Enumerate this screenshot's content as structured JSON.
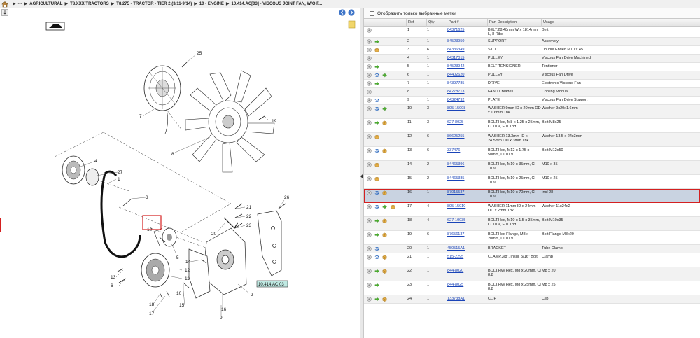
{
  "breadcrumb": {
    "items": [
      "---",
      "AGRICULTURAL",
      "T8.XXX TRACTORS",
      "T8.275 - TRACTOR - TIER 2 (3/11-9/14)",
      "10 - ENGINE",
      "10.414.AC[03] - VISCOUS JOINT FAN, W/O F..."
    ]
  },
  "filter": {
    "label": "Отобразить только выбранные метки"
  },
  "table": {
    "headers": [
      "Ref",
      "Qty",
      "Part #",
      "Part Description",
      "Usage"
    ],
    "rows": [
      {
        "ref": "1",
        "qty": "1",
        "part": "84371625",
        "desc": "BELT,28.48mm W x 1814mm L, 8 Ribs",
        "usage": "Belt",
        "icons": [
          "info"
        ]
      },
      {
        "ref": "2",
        "qty": "1",
        "part": "84523950",
        "desc": "SUPPORT",
        "usage": "Assembly",
        "icons": [
          "info",
          "arrow"
        ]
      },
      {
        "ref": "3",
        "qty": "6",
        "part": "84336349",
        "desc": "STUD",
        "usage": "Double Ended M10 x 45",
        "icons": [
          "info",
          "box"
        ]
      },
      {
        "ref": "4",
        "qty": "1",
        "part": "84317015",
        "desc": "PULLEY",
        "usage": "Viscous Fan Drive Machined",
        "icons": [
          "info"
        ]
      },
      {
        "ref": "5",
        "qty": "1",
        "part": "84523942",
        "desc": "BELT TENSIONER",
        "usage": "Tentioner",
        "icons": [
          "info",
          "arrow"
        ]
      },
      {
        "ref": "6",
        "qty": "1",
        "part": "84402620",
        "desc": "PULLEY",
        "usage": "Viscous Fan Drive",
        "icons": [
          "info",
          "swap",
          "arrow"
        ]
      },
      {
        "ref": "7",
        "qty": "1",
        "part": "84397785",
        "desc": "DRIVE",
        "usage": "Electronic Viscous Fan",
        "icons": [
          "info",
          "arrow"
        ]
      },
      {
        "ref": "8",
        "qty": "1",
        "part": "84278713",
        "desc": "FAN,11 Blades",
        "usage": "Cooling Modual",
        "icons": [
          "info"
        ]
      },
      {
        "ref": "9",
        "qty": "1",
        "part": "84324792",
        "desc": "PLATE",
        "usage": "Viscous Fan Drive Support",
        "icons": [
          "info",
          "swap"
        ]
      },
      {
        "ref": "10",
        "qty": "3",
        "part": "895-15008",
        "desc": "WASHER,9mm ID x 20mm OD x 1.6mm Thk",
        "usage": "Washer 9x20x1.6mm",
        "icons": [
          "info",
          "swap",
          "arrow"
        ]
      },
      {
        "ref": "11",
        "qty": "3",
        "part": "627-8025",
        "desc": "BOLT,Hex, M8 x 1.25 x 25mm, Cl 10.9, Full Thd",
        "usage": "Bolt M8x25",
        "icons": [
          "info",
          "arrow",
          "box"
        ]
      },
      {
        "ref": "12",
        "qty": "6",
        "part": "86625255",
        "desc": "WASHER,13.3mm ID x 24.5mm OD x 3mm Thk",
        "usage": "Washer 13.5 x 24x3mm",
        "icons": [
          "info",
          "box"
        ]
      },
      {
        "ref": "13",
        "qty": "6",
        "part": "337476",
        "desc": "BOLT,Hex, M12 x 1.75 x 50mm, Cl 10.9",
        "usage": "Bolt M12x50",
        "icons": [
          "info",
          "swap",
          "box"
        ]
      },
      {
        "ref": "14",
        "qty": "2",
        "part": "84465396",
        "desc": "BOLT,Hex, M10 x 35mm, Cl 10.9",
        "usage": "M10 x 35",
        "icons": [
          "info",
          "box"
        ]
      },
      {
        "ref": "15",
        "qty": "2",
        "part": "84465385",
        "desc": "BOLT,Hex, M10 x 25mm, Cl 10.9",
        "usage": "M10 x 25",
        "icons": [
          "info",
          "box"
        ]
      },
      {
        "ref": "16",
        "qty": "1",
        "part": "87015537",
        "desc": "BOLT,Hex, M10 x 70mm, Cl 10.9",
        "usage": "Incl 28",
        "icons": [
          "info",
          "swap",
          "box"
        ],
        "selected": true
      },
      {
        "ref": "17",
        "qty": "4",
        "part": "895-15010",
        "desc": "WASHER,11mm ID x 24mm OD x 2mm Thk",
        "usage": "Washer 11x24x2",
        "icons": [
          "info",
          "swap",
          "arrow",
          "box"
        ]
      },
      {
        "ref": "18",
        "qty": "4",
        "part": "627-10035",
        "desc": "BOLT,Hex, M10 x 1.5 x 35mm, Cl 10.9, Full Thd",
        "usage": "Bolt M10x35",
        "icons": [
          "info",
          "arrow",
          "box"
        ]
      },
      {
        "ref": "19",
        "qty": "6",
        "part": "87656137",
        "desc": "BOLT,Hex Flange, M8 x 20mm, Cl 10.9",
        "usage": "Bolt Flange M8x20",
        "icons": [
          "info",
          "arrow",
          "box"
        ]
      },
      {
        "ref": "20",
        "qty": "1",
        "part": "450515A1",
        "desc": "BRACKET",
        "usage": "Tube Clamp",
        "icons": [
          "info",
          "swap"
        ]
      },
      {
        "ref": "21",
        "qty": "1",
        "part": "515-2295",
        "desc": "CLAMP,3/8\", Insul, 5/16\" Bolt",
        "usage": "Clamp",
        "icons": [
          "info",
          "swap",
          "box"
        ]
      },
      {
        "ref": "22",
        "qty": "1",
        "part": "844-8020",
        "desc": "BOLT,Hvy Hex, M8 x 20mm, Cl 8.8",
        "usage": "M8 x 20",
        "icons": [
          "info",
          "arrow",
          "box"
        ]
      },
      {
        "ref": "23",
        "qty": "1",
        "part": "844-8025",
        "desc": "BOLT,Hvy Hex, M8 x 25mm, Cl 8.8",
        "usage": "M8 x 25",
        "icons": [
          "info",
          "arrow"
        ]
      },
      {
        "ref": "24",
        "qty": "1",
        "part": "133738A1",
        "desc": "CLIP",
        "usage": "Clip",
        "icons": [
          "info",
          "arrow",
          "box"
        ]
      }
    ]
  },
  "diagram": {
    "callouts": [
      "25",
      "7",
      "8",
      "19",
      "4",
      "27",
      "1",
      "3",
      "21",
      "22",
      "23",
      "26",
      "20",
      "10",
      "5",
      "14",
      "12",
      "13",
      "6",
      "11",
      "10",
      "15",
      "16",
      "9",
      "18",
      "17",
      "2"
    ],
    "tag": "10.414.AC 03"
  },
  "colors": {
    "link": "#1a44b8",
    "selection_outline": "#d42020",
    "selection_fill": "#c9d3e1",
    "tag_fill": "#bfe9e2"
  },
  "icons": {
    "home": "home-icon",
    "back": "back-arrow-icon",
    "forward": "forward-arrow-icon",
    "info": "info-icon",
    "swap": "swap-icon",
    "arrow": "green-arrow-icon",
    "box": "package-icon"
  }
}
